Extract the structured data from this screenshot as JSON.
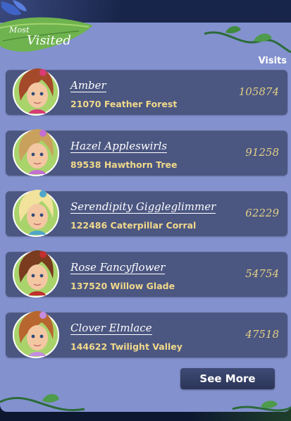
{
  "header": {
    "badge_line1": "Most",
    "badge_line2": "Visited",
    "visits_label": "Visits"
  },
  "rows": [
    {
      "name": "Amber",
      "place": "21070 Feather Forest",
      "visits": "105874",
      "hair": "#a44a2a",
      "accent": "#d93b77"
    },
    {
      "name": "Hazel Appleswirls",
      "place": "89538 Hawthorn Tree",
      "visits": "91258",
      "hair": "#c9a15c",
      "accent": "#c56fd1"
    },
    {
      "name": "Serendipity Giggleglimmer",
      "place": "122486 Caterpillar Corral",
      "visits": "62229",
      "hair": "#f1e29c",
      "accent": "#4fa6c9"
    },
    {
      "name": "Rose Fancyflower",
      "place": "137520 Willow Glade",
      "visits": "54754",
      "hair": "#7a3b1f",
      "accent": "#c12f2f"
    },
    {
      "name": "Clover Elmlace",
      "place": "144622 Twilight Valley",
      "visits": "47518",
      "hair": "#b8662f",
      "accent": "#c58de0"
    }
  ],
  "footer": {
    "see_more_label": "See More"
  }
}
